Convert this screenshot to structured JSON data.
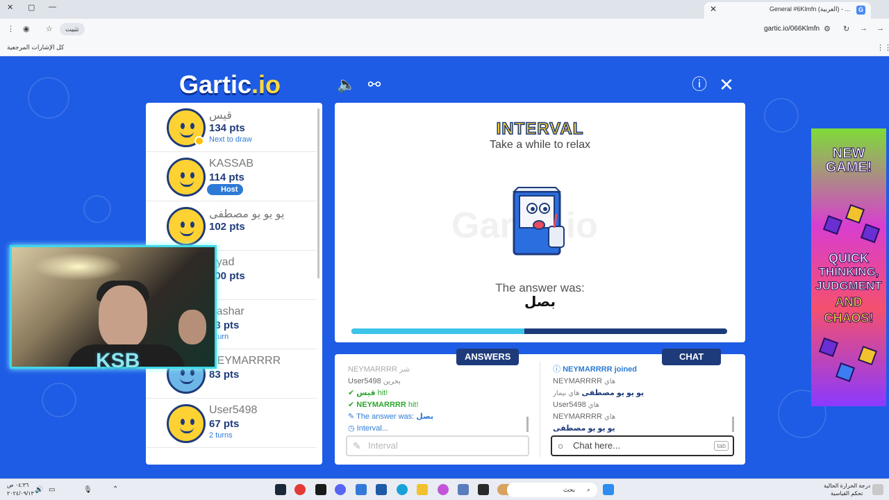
{
  "browser": {
    "tab_title": "General #6Klmfn (العربية) - ...",
    "url": "gartic.io/066Klmfn",
    "install_pill": "تثبيت",
    "bookmarks_label": "كل الإشارات المرجعية"
  },
  "game": {
    "logo_text": "Gartic",
    "logo_suffix": ".io",
    "interval_title": "INTERVAL",
    "interval_subtitle": "Take a while to relax",
    "answer_label": "The answer was:",
    "answer_word": "بصل",
    "progress_fraction": 0.46,
    "watermark": "Gartic.io"
  },
  "players": [
    {
      "name": "قيس",
      "points": "134 pts",
      "note": "Next to draw"
    },
    {
      "name": "KASSAB",
      "points": "114 pts",
      "badge": "Host"
    },
    {
      "name": "يو يو يو مصطفى",
      "points": "102 pts"
    },
    {
      "name": "Eyad",
      "points": "100 pts"
    },
    {
      "name": "Bashar",
      "points": "83 pts",
      "note": "1 turn"
    },
    {
      "name": "NEYMARRRR",
      "points": "83 pts"
    },
    {
      "name": "User5498",
      "points": "67 pts",
      "note": "2 turns"
    }
  ],
  "webcam": {
    "overlay_text": "KSB"
  },
  "answers": {
    "tab_label": "ANSWERS",
    "lines": [
      {
        "name": "NEYMARRRR",
        "text": "شر"
      },
      {
        "name": "User5498",
        "text": "بحرين"
      },
      {
        "hit_name": "قيس",
        "hit_text": "hit!"
      },
      {
        "hit_name": "NEYMARRRR",
        "hit_text": "hit!"
      },
      {
        "answer_prefix": "The answer was:",
        "answer_word": "بصل"
      },
      {
        "interval": "Interval..."
      }
    ],
    "input_placeholder": "Interval"
  },
  "chat": {
    "tab_label": "CHAT",
    "joined": "NEYMARRRR joined",
    "lines": [
      {
        "name": "NEYMARRRR",
        "text": "هاي"
      },
      {
        "name": "يو يو يو مصطفى",
        "text": "هاي نيمار"
      },
      {
        "name": "User5498",
        "text": "هاي"
      },
      {
        "name": "NEYMARRRR",
        "text": "هاي"
      },
      {
        "name": "يو يو يو مصطفى",
        "text": ""
      }
    ],
    "input_placeholder": "Chat here...",
    "tab_key": "tab"
  },
  "ad": {
    "headline": "NEW GAME!",
    "line1": "QUICK",
    "line2": "THINKING,",
    "line3": "JUDGMENT",
    "line4": "AND",
    "line5": "CHAOS!"
  },
  "taskbar": {
    "search_placeholder": "بحث",
    "weather_line1": "درجة الحرارة الحالية",
    "weather_line2": "تحكم القياسية",
    "time": "٠٤:٣٦ ص",
    "date": "٢٠٢٤/٠٩/١٣"
  },
  "colors": {
    "page_bg": "#1e5ce6",
    "navy": "#1d3a7a",
    "accent_blue": "#2d7ad6",
    "progress_fill": "#3cc3e8",
    "hit_green": "#2fa52f"
  }
}
